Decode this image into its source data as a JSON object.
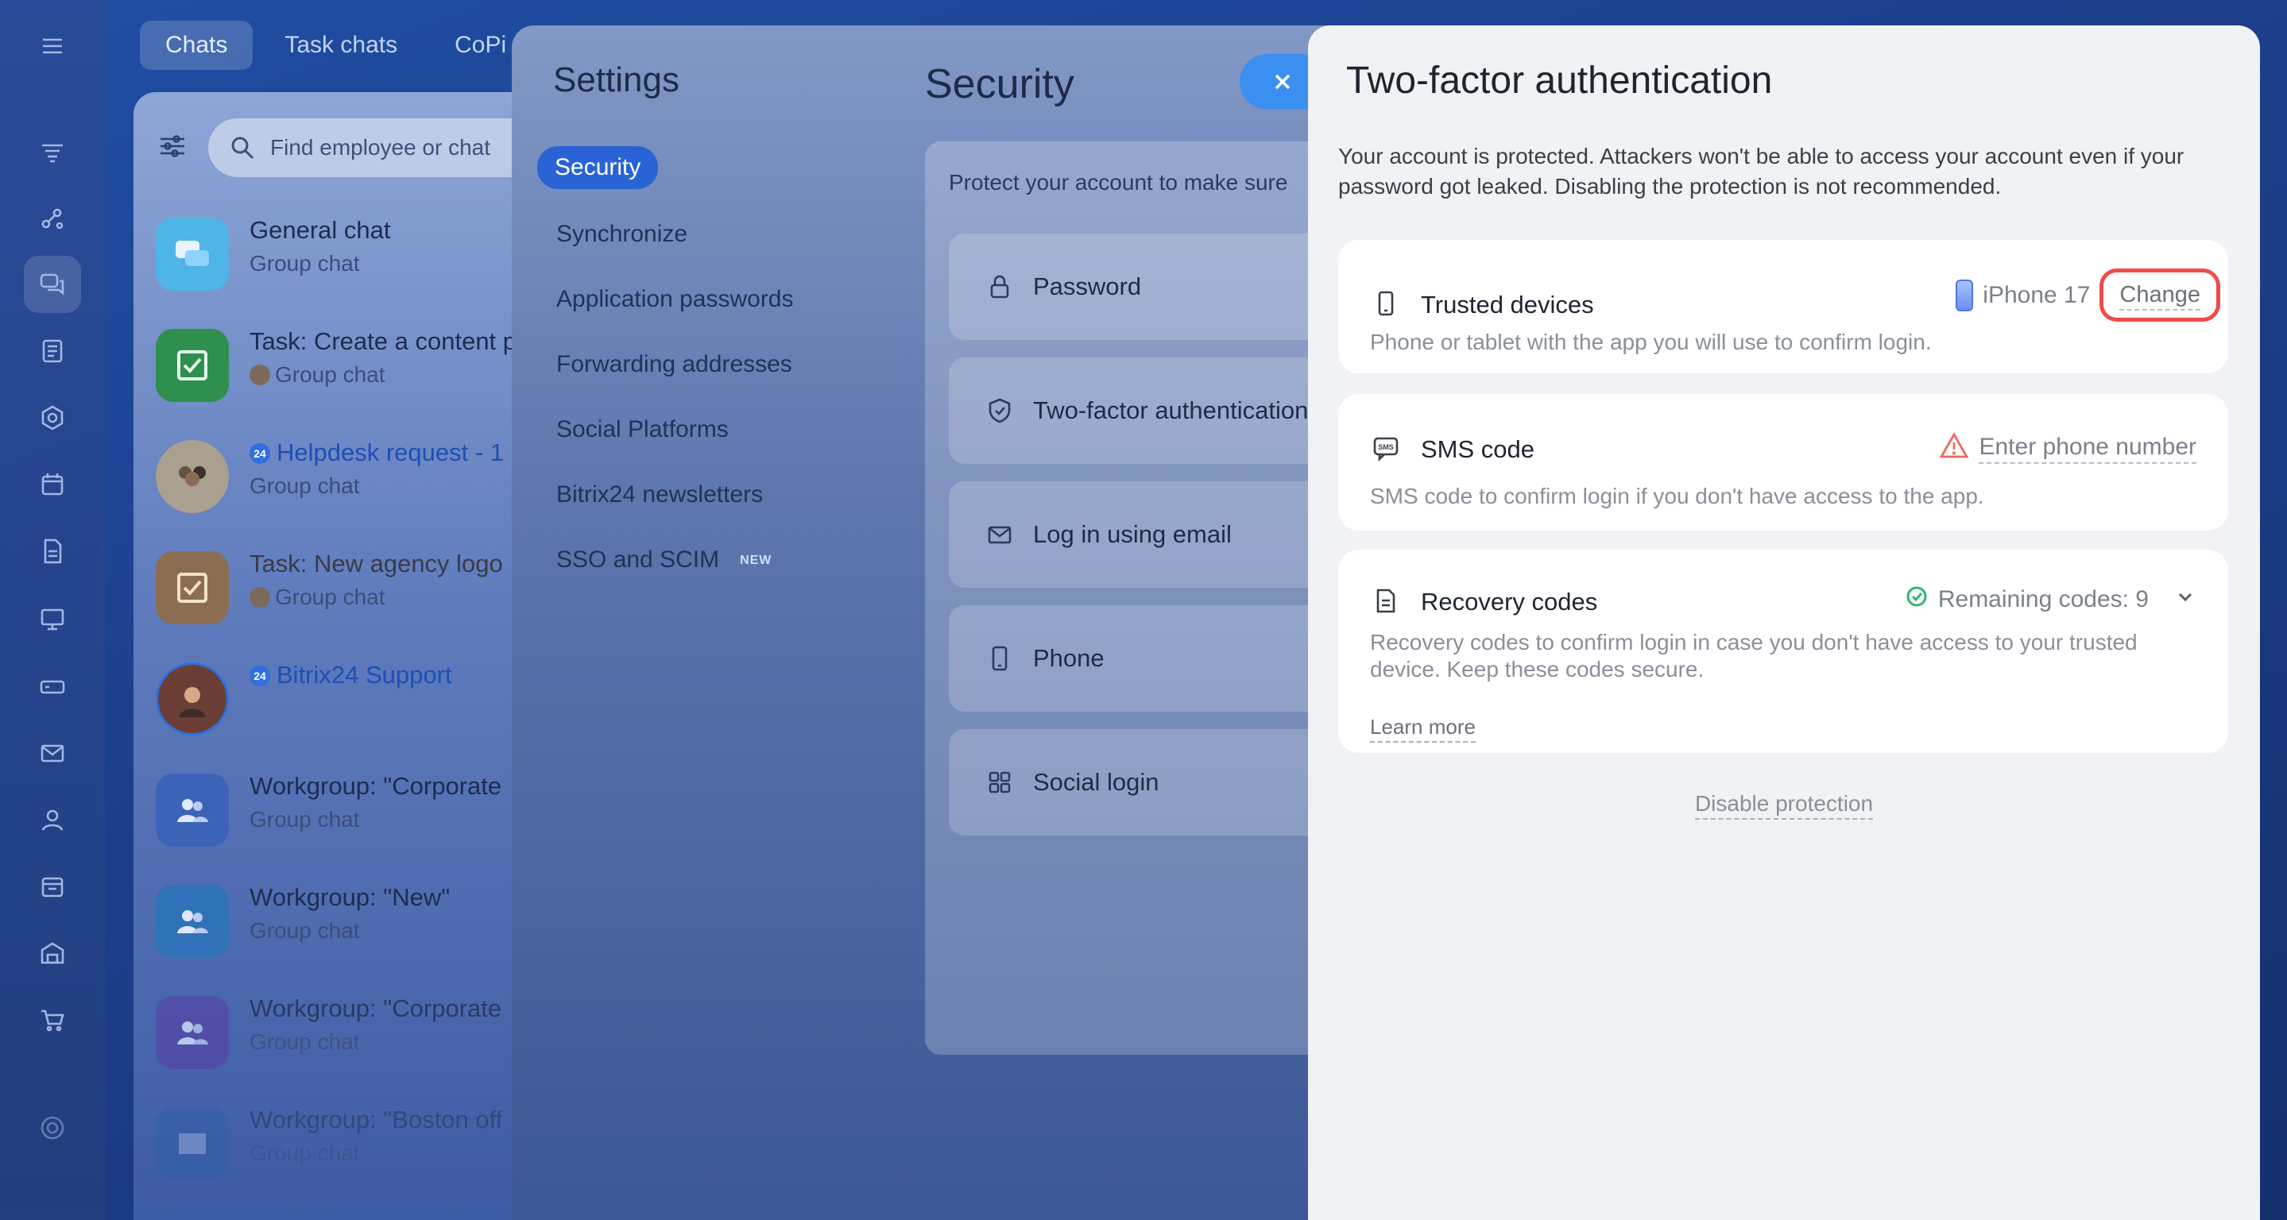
{
  "rail": {
    "icons": [
      "menu-icon",
      "feed-icon",
      "collab-icon",
      "chat-icon",
      "tasks-icon",
      "hexagon-icon",
      "calendar-icon",
      "docs-icon",
      "board-icon",
      "drive-icon",
      "mail-icon",
      "contacts-icon",
      "workgroups-icon",
      "store-icon",
      "cart-icon",
      "settings-icon"
    ]
  },
  "chat_tabs": [
    "Chats",
    "Task chats",
    "CoPi"
  ],
  "chat_search": {
    "placeholder": "Find employee or chat"
  },
  "chats": [
    {
      "name": "General chat",
      "sub": "Group chat"
    },
    {
      "name": "Task: Create a content p",
      "sub": "Group chat"
    },
    {
      "name": "Helpdesk request - 1",
      "sub": "Group chat"
    },
    {
      "name": "Task: New agency logo",
      "sub": "Group chat"
    },
    {
      "name": "Bitrix24 Support",
      "sub": ""
    },
    {
      "name": "Workgroup: \"Corporate",
      "sub": "Group chat"
    },
    {
      "name": "Workgroup: \"New\"",
      "sub": "Group chat"
    },
    {
      "name": "Workgroup: \"Corporate",
      "sub": "Group chat"
    },
    {
      "name": "Workgroup: \"Boston off",
      "sub": "Group chat"
    }
  ],
  "settings": {
    "title": "Settings",
    "nav": [
      "Security",
      "Synchronize",
      "Application passwords",
      "Forwarding addresses",
      "Social Platforms",
      "Bitrix24 newsletters",
      "SSO and SCIM"
    ],
    "new_badge": "NEW",
    "security_title": "Security",
    "security_intro": "Protect your account to make sure",
    "security_rows": [
      "Password",
      "Two-factor authentication",
      "Log in using email",
      "Phone",
      "Social login"
    ]
  },
  "tfa": {
    "title": "Two-factor authentication",
    "description": "Your account is protected. Attackers won't be able to access your account even if your password got leaked. Disabling the protection is not recommended.",
    "trusted": {
      "title": "Trusted devices",
      "device": "iPhone 17",
      "change_label": "Change",
      "desc": "Phone or tablet with the app you will use to confirm login."
    },
    "sms": {
      "title": "SMS code",
      "action": "Enter phone number",
      "desc": "SMS code to confirm login if you don't have access to the app."
    },
    "recovery": {
      "title": "Recovery codes",
      "status": "Remaining codes: 9",
      "desc": "Recovery codes to confirm login in case you don't have access to your trusted device. Keep these codes secure.",
      "learn_more": "Learn more"
    },
    "disable_label": "Disable protection"
  },
  "colors": {
    "accent": "#2a63d6",
    "highlight_ring": "#ef4b4b",
    "warning": "#ef6a5f",
    "success": "#2fb872"
  }
}
